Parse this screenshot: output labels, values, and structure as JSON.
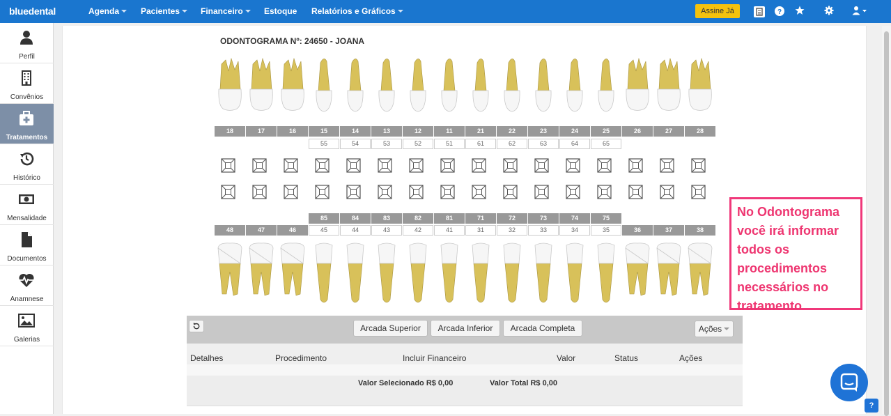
{
  "brand": {
    "name": "bluedental"
  },
  "nav": {
    "agenda": "Agenda",
    "pacientes": "Pacientes",
    "financeiro": "Financeiro",
    "estoque": "Estoque",
    "relatorios": "Relatórios e Gráficos",
    "assine": "Assine Já"
  },
  "top_icons": [
    "clipboard-icon",
    "help-icon",
    "star-icon",
    "gear-icon",
    "user-icon"
  ],
  "sidebar": {
    "items": [
      {
        "label": "Perfil",
        "icon": "user-icon"
      },
      {
        "label": "Convênios",
        "icon": "building-icon"
      },
      {
        "label": "Tratamentos",
        "icon": "medkit-icon",
        "active": true
      },
      {
        "label": "Histórico",
        "icon": "history-icon"
      },
      {
        "label": "Mensalidade",
        "icon": "money-icon"
      },
      {
        "label": "Documentos",
        "icon": "document-icon"
      },
      {
        "label": "Anamnese",
        "icon": "heartbeat-icon"
      },
      {
        "label": "Galerias",
        "icon": "image-icon"
      }
    ]
  },
  "odontogram": {
    "title": "ODONTOGRAMA Nº: 24650 - JOANA",
    "upper_permanent": [
      "18",
      "17",
      "16",
      "15",
      "14",
      "13",
      "12",
      "11",
      "21",
      "22",
      "23",
      "24",
      "25",
      "26",
      "27",
      "28"
    ],
    "upper_deciduous": [
      "55",
      "54",
      "53",
      "52",
      "51",
      "61",
      "62",
      "63",
      "64",
      "65"
    ],
    "lower_deciduous": [
      "85",
      "84",
      "83",
      "82",
      "81",
      "71",
      "72",
      "73",
      "74",
      "75"
    ],
    "lower_permanent": [
      "48",
      "47",
      "46",
      "45",
      "44",
      "43",
      "42",
      "41",
      "31",
      "32",
      "33",
      "34",
      "35",
      "36",
      "37",
      "38"
    ]
  },
  "controls": {
    "undo_icon": "undo-icon",
    "arcada_superior": "Arcada Superior",
    "arcada_inferior": "Arcada Inferior",
    "arcada_completa": "Arcada Completa",
    "acoes": "Ações"
  },
  "table": {
    "headers": [
      "Detalhes",
      "Procedimento",
      "Incluir Financeiro",
      "Valor",
      "Status",
      "Ações"
    ],
    "valor_selecionado": "Valor Selecionado R$ 0,00",
    "valor_total": "Valor Total R$ 0,00"
  },
  "callout": {
    "lines": [
      "No Odontograma",
      "você irá informar",
      "todos os",
      "procedimentos",
      "necessários no",
      "tratamento"
    ]
  },
  "colors": {
    "nav_bg": "#1a76cf",
    "sidebar_active": "#7d8fa7",
    "callout": "#ee3570",
    "assine_bg": "#f4c20d",
    "tooth_root": "#d8c15a",
    "tooth_crown": "#f6f6f6"
  }
}
